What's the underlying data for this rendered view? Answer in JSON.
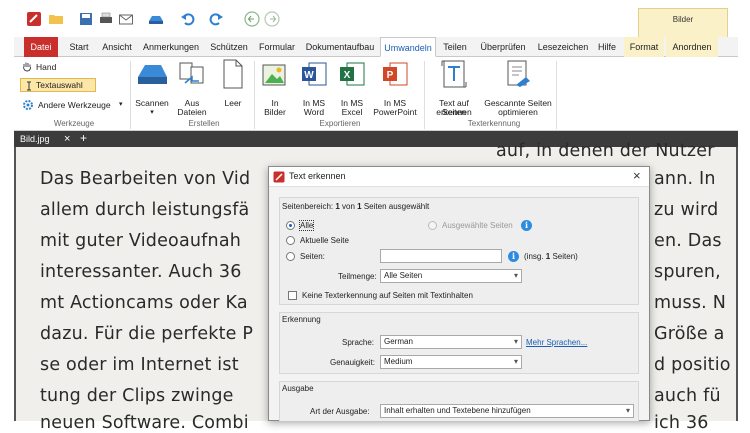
{
  "toolbar": {
    "icons": [
      "app-logo-icon",
      "open-folder-icon",
      "save-icon",
      "print-icon",
      "email-icon",
      "scanner-icon",
      "undo-icon",
      "redo-icon",
      "back-icon",
      "forward-icon"
    ]
  },
  "context_group": {
    "label": "Bilder"
  },
  "tabs": [
    "Datei",
    "Start",
    "Ansicht",
    "Anmerkungen",
    "Schützen",
    "Formular",
    "Dokumentaufbau",
    "Umwandeln",
    "Teilen",
    "Überprüfen",
    "Lesezeichen",
    "Hilfe",
    "Format",
    "Anordnen"
  ],
  "ribbon": {
    "tools": {
      "hand": "Hand",
      "text_select": "Textauswahl",
      "other_tools": "Andere Werkzeuge",
      "group": "Werkzeuge"
    },
    "create": {
      "scan": "Scannen",
      "from_files_1": "Aus",
      "from_files_2": "Dateien",
      "empty": "Leer",
      "group": "Erstellen"
    },
    "export": {
      "img_1": "In",
      "img_2": "Bilder",
      "word_1": "In MS",
      "word_2": "Word",
      "excel_1": "In MS",
      "excel_2": "Excel",
      "ppt_1": "In MS",
      "ppt_2": "PowerPoint",
      "group": "Exportieren"
    },
    "ocr": {
      "recognize_1": "Text auf Seiten",
      "recognize_2": "erkennen",
      "optimize_1": "Gescannte Seiten",
      "optimize_2": "optimieren",
      "group": "Texterkennung"
    }
  },
  "doc_tab": {
    "name": "Bild.jpg",
    "close": "×",
    "add": "+"
  },
  "document_lines": [
    {
      "left": "Das Bearbeiten von Vid",
      "right": "ann. In"
    },
    {
      "left": "allem durch leistungsfä",
      "right": "zu wird"
    },
    {
      "left": "mit guter Videoaufnah",
      "right": "en. Das"
    },
    {
      "left": "interessanter. Auch 36",
      "right": "spuren,"
    },
    {
      "left": "mt Actioncams oder Ka",
      "right": "muss. N"
    },
    {
      "left": "dazu. Für die perfekte P",
      "right": "Größe a"
    },
    {
      "left": "se oder im Internet ist",
      "right": "d positio"
    },
    {
      "left": "tung der Clips zwinge",
      "right": "auch fü"
    }
  ],
  "doc_top_right": "auf, in denen der Nutzer",
  "doc_bottom_left": "neuen Software. Combi",
  "doc_bottom_right": "ich 36",
  "dialog": {
    "title": "Text erkennen",
    "close": "×",
    "range_label_pre": "Seitenbereich: ",
    "range_count": "1",
    "range_label_mid": " von ",
    "range_total": "1",
    "range_label_post": " Seiten ausgewählt",
    "opt_all": "Alle",
    "opt_selected": "Ausgewählte Seiten",
    "opt_current": "Aktuelle Seite",
    "opt_pages": "Seiten:",
    "pages_value": "",
    "pages_total_pre": "(insg. ",
    "pages_total_num": "1",
    "pages_total_post": " Seiten)",
    "subset_label": "Teilmenge:",
    "subset_value": "Alle Seiten",
    "skip_text_pages": "Keine Texterkennung auf Seiten mit Textinhalten",
    "recognition_header": "Erkennung",
    "language_label": "Sprache:",
    "language_value": "German",
    "more_languages": "Mehr Sprachen...",
    "accuracy_label": "Genauigkeit:",
    "accuracy_value": "Medium",
    "output_header": "Ausgabe",
    "output_type_label": "Art der Ausgabe:",
    "output_type_value": "Inhalt erhalten und Textebene hinzufügen"
  },
  "colors": {
    "file_tab": "#c9302c",
    "accent": "#1a5fb4",
    "context": "#fbf1c8"
  }
}
